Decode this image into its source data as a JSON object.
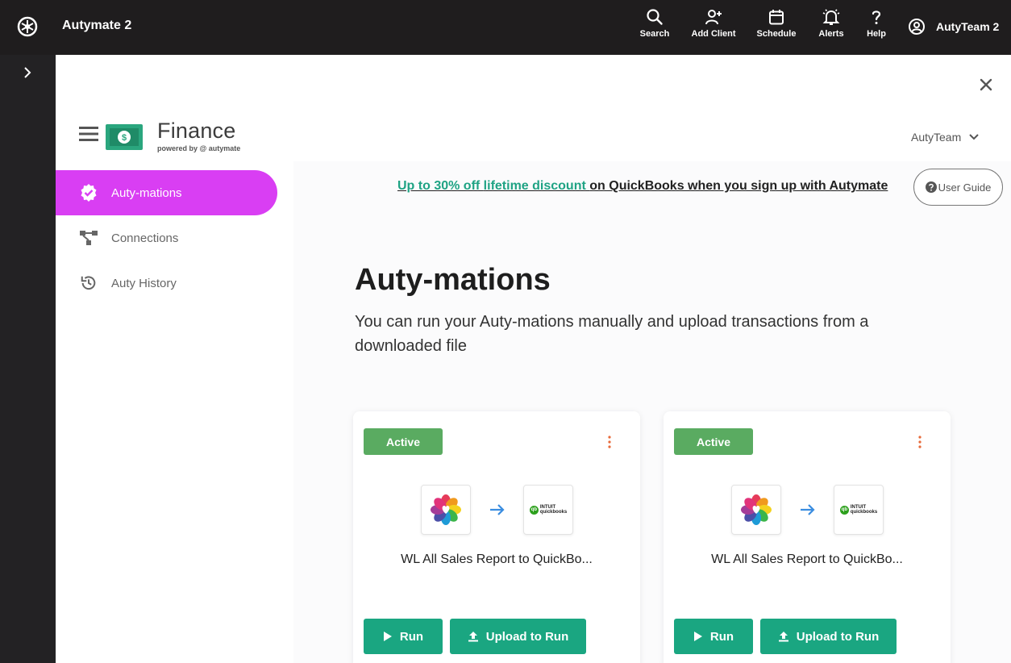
{
  "topbar": {
    "app_title": "Autymate 2",
    "nav": [
      {
        "label": "Search",
        "icon": "search-icon"
      },
      {
        "label": "Add Client",
        "icon": "add-user-icon"
      },
      {
        "label": "Schedule",
        "icon": "calendar-icon"
      },
      {
        "label": "Alerts",
        "icon": "bell-icon"
      },
      {
        "label": "Help",
        "icon": "question-icon"
      }
    ],
    "user_name": "AutyTeam 2"
  },
  "header": {
    "title": "Finance",
    "powered_by": "powered by @ autymate",
    "team": "AutyTeam"
  },
  "sidebar": {
    "items": [
      {
        "label": "Auty-mations",
        "icon": "badge-check-icon",
        "active": true
      },
      {
        "label": "Connections",
        "icon": "connections-icon",
        "active": false
      },
      {
        "label": "Auty History",
        "icon": "history-icon",
        "active": false
      }
    ]
  },
  "promo": {
    "highlight_prefix": "Up to 30% off ",
    "highlight_bold": "lifetime discount ",
    "rest": "on QuickBooks when you sign up with Autymate"
  },
  "user_guide_label": "User Guide",
  "page": {
    "title": "Auty-mations",
    "subtitle": "You can run your Auty-mations manually and upload transactions from a downloaded file"
  },
  "cards": [
    {
      "status": "Active",
      "title": "WL All Sales Report to QuickBo...",
      "run_label": "Run",
      "upload_label": "Upload to Run"
    },
    {
      "status": "Active",
      "title": "WL All Sales Report to QuickBo...",
      "run_label": "Run",
      "upload_label": "Upload to Run"
    }
  ],
  "quickbooks": {
    "brand_top": "INTUIT",
    "brand_bottom": "quickbooks",
    "dot": "qb"
  },
  "colors": {
    "topbar": "#1f1d1e",
    "accent_active": "#d93ef3",
    "primary_button": "#1aa681",
    "status_active": "#5aab61",
    "promo_green": "#1fa384"
  }
}
